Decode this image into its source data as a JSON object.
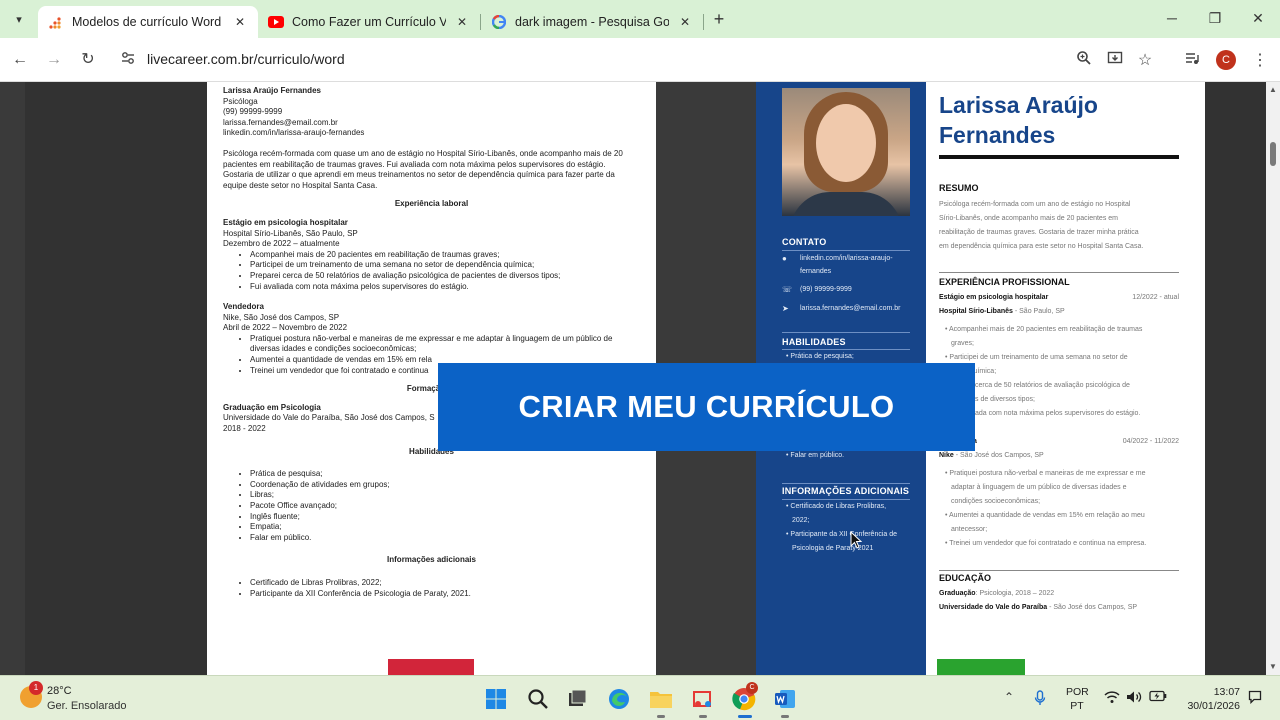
{
  "browser": {
    "tabs": [
      {
        "title": "Modelos de currículo Word pro",
        "active": true,
        "favicon": "livecareer-icon"
      },
      {
        "title": "Como Fazer um Currículo Vitae",
        "active": false,
        "favicon": "youtube-icon"
      },
      {
        "title": "dark imagem - Pesquisa Googl",
        "active": false,
        "favicon": "google-icon"
      }
    ],
    "url": "livecareer.com.br/curriculo/word",
    "profile_initial": "C"
  },
  "resume_plain": {
    "name": "Larissa Araújo Fernandes",
    "role": "Psicóloga",
    "phone": "(99) 99999-9999",
    "email": "larissa.fernandes@email.com.br",
    "linkedin": "linkedin.com/in/larissa-araujo-fernandes",
    "summary_1": "Psicóloga recém-formada com quase um ano de estágio no Hospital Sírio-Libanês, onde acompanho mais de 20",
    "summary_2": "pacientes em reabilitação de traumas graves. Fui avaliada com nota máxima pelos supervisores do estágio.",
    "summary_3": "Gostaria de utilizar o que aprendi em meus treinamentos no setor de dependência química para fazer parte da",
    "summary_4": "equipe deste setor no Hospital Santa Casa.",
    "exp_heading": "Experiência laboral",
    "job1_title": "Estágio em psicologia hospitalar",
    "job1_place": "Hospital Sírio-Libanês, São Paulo, SP",
    "job1_dates": "Dezembro de 2022 – atualmente",
    "job1_bullets": [
      "Acompanhei mais de 20 pacientes em reabilitação de traumas graves;",
      "Participei de um treinamento de uma semana no setor de dependência química;",
      "Preparei cerca de 50 relatórios de avaliação psicológica de pacientes de diversos tipos;",
      "Fui avaliada com nota máxima pelos supervisores do estágio."
    ],
    "job2_title": "Vendedora",
    "job2_place": "Nike, São José dos Campos, SP",
    "job2_dates": "Abril de 2022 – Novembro de 2022",
    "job2_bullet1a": "Pratiquei postura não-verbal e maneiras de me expressar e me adaptar à linguagem de um público de",
    "job2_bullet1b": "diversas idades e condições socioeconômicas;",
    "job2_bullet2": "Aumentei a quantidade de vendas em 15% em rela",
    "job2_bullet3": "Treinei um vendedor que foi contratado e continua",
    "edu_heading": "Formação ac",
    "edu_title": "Graduação em Psicologia",
    "edu_place": "Universidade do Vale do Paraíba, São José dos Campos, S",
    "edu_dates": "2018 - 2022",
    "skills_heading": "Habilidades",
    "skills": [
      "Prática de pesquisa;",
      "Coordenação de atividades em grupos;",
      "Libras;",
      "Pacote Office avançado;",
      "Inglês fluente;",
      "Empatia;",
      "Falar em público."
    ],
    "extra_heading": "Informações adicionais",
    "extra": [
      "Certificado de Libras Prolibras, 2022;",
      "Participante da XII Conferência de Psicologia de Paraty, 2021."
    ]
  },
  "resume_blue": {
    "name_line1": "Larissa Araújo",
    "name_line2": "Fernandes",
    "contact_title": "CONTATO",
    "contact_linkedin_1": "linkedin.com/in/larissa-araujo-",
    "contact_linkedin_2": "fernandes",
    "contact_phone": "(99) 99999-9999",
    "contact_email": "larissa.fernandes@email.com.br",
    "skills_title": "HABILIDADES",
    "skill_first": "• Prática de pesquisa;",
    "skill_last": "• Falar em público.",
    "extra_title": "INFORMAÇÕES ADICIONAIS",
    "extra_1a": "• Certificado de Libras Prolibras,",
    "extra_1b": "2022;",
    "extra_2a": "• Participante da XII Conferência de",
    "extra_2b": "Psicologia de Paraty 2021",
    "summary_title": "RESUMO",
    "summary_1": "Psicóloga recém-formada com um ano de estágio no Hospital",
    "summary_2": "Sírio-Libanês, onde acompanho mais de 20 pacientes em",
    "summary_3": "reabilitação de traumas graves. Gostaria de trazer minha prática",
    "summary_4": "em dependência química para este setor no Hospital Santa Casa.",
    "exp_title": "EXPERIÊNCIA PROFISSIONAL",
    "job1_title": "Estágio em psicologia hospitalar",
    "job1_dates": "12/2022 - atual",
    "job1_place_bold": "Hospital Sírio-Libanês",
    "job1_place_rest": " - São Paulo, SP",
    "job1_b1a": "• Acompanhei mais de 20 pacientes em reabilitação de traumas",
    "job1_b1b": "graves;",
    "job1_b2a": "• Participei de um treinamento de uma semana no setor de",
    "job1_b2b": "ência química;",
    "job1_b3a": "cerca de 50 relatórios de avaliação psicológica de",
    "job1_b3b": "s de diversos tipos;",
    "job1_b4": "ada com nota máxima pelos supervisores do estágio.",
    "job2_title_tail": "a",
    "job2_dates": "04/2022 - 11/2022",
    "job2_place_bold": "Nike",
    "job2_place_rest": " - São José dos Campos, SP",
    "job2_b1a": "• Pratiquei postura não-verbal e maneiras de me expressar e me",
    "job2_b1b": "adaptar à linguagem de um público de diversas idades e",
    "job2_b1c": "condições socioeconômicas;",
    "job2_b2a": "• Aumentei a quantidade de vendas em 15% em relação ao meu",
    "job2_b2b": "antecessor;",
    "job2_b3": "• Treinei um vendedor que foi contratado e continua na empresa.",
    "edu_title": "EDUCAÇÃO",
    "edu_line1_bold": "Graduação",
    "edu_line1_rest": ": Psicologia, 2018 – 2022",
    "edu_line2_bold": "Universidade do Vale do Paraíba",
    "edu_line2_rest": " - São José dos Campos, SP"
  },
  "cta_label": "CRIAR MEU CURRÍCULO",
  "taskbar": {
    "weather_temp": "28°C",
    "weather_desc": "Ger. Ensolarado",
    "weather_badge": "1",
    "lang_1": "POR",
    "lang_2": "PT",
    "time": "13:07",
    "date": "30/01/2026",
    "chrome_badge": "C"
  },
  "colors": {
    "tabbar_bg": "#d9f1d5",
    "resume_blue": "#17458a",
    "cta_blue": "#0b62c6",
    "taskbar_bg": "#e4efd9"
  }
}
